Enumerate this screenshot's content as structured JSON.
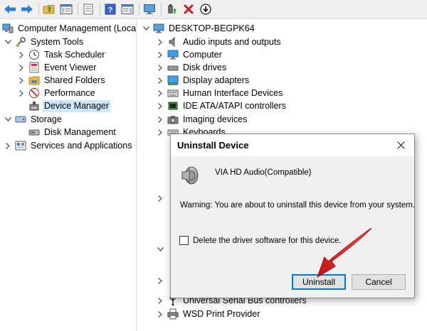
{
  "toolbar": {
    "buttons": [
      "back-icon",
      "forward-icon",
      "up-folder-icon",
      "show-hide-tree-icon",
      "properties-icon",
      "help-icon",
      "action-pane-icon",
      "monitor-icon",
      "update-driver-icon",
      "uninstall-icon",
      "scan-icon"
    ]
  },
  "left_tree": {
    "root": "Computer Management (Local",
    "system_tools": "System Tools",
    "task_scheduler": "Task Scheduler",
    "event_viewer": "Event Viewer",
    "shared_folders": "Shared Folders",
    "performance": "Performance",
    "device_manager": "Device Manager",
    "storage": "Storage",
    "disk_management": "Disk Management",
    "services": "Services and Applications"
  },
  "device_tree": {
    "computer_name": "DESKTOP-BEGPK64",
    "categories": [
      "Audio inputs and outputs",
      "Computer",
      "Disk drives",
      "Display adapters",
      "Human Interface Devices",
      "IDE ATA/ATAPI controllers",
      "Imaging devices",
      "Keyboards"
    ],
    "bottom_categories": [
      "Universal Serial Bus controllers",
      "WSD Print Provider"
    ]
  },
  "dialog": {
    "title": "Uninstall Device",
    "device_name": "VIA HD Audio(Compatible)",
    "warning": "Warning: You are about to uninstall this device from your system.",
    "checkbox_label": "Delete the driver software for this device.",
    "checkbox_checked": false,
    "uninstall_label": "Uninstall",
    "cancel_label": "Cancel"
  },
  "colors": {
    "selection": "#cce8ff",
    "accent": "#0078d7",
    "annotation_arrow": "#e8141b"
  }
}
